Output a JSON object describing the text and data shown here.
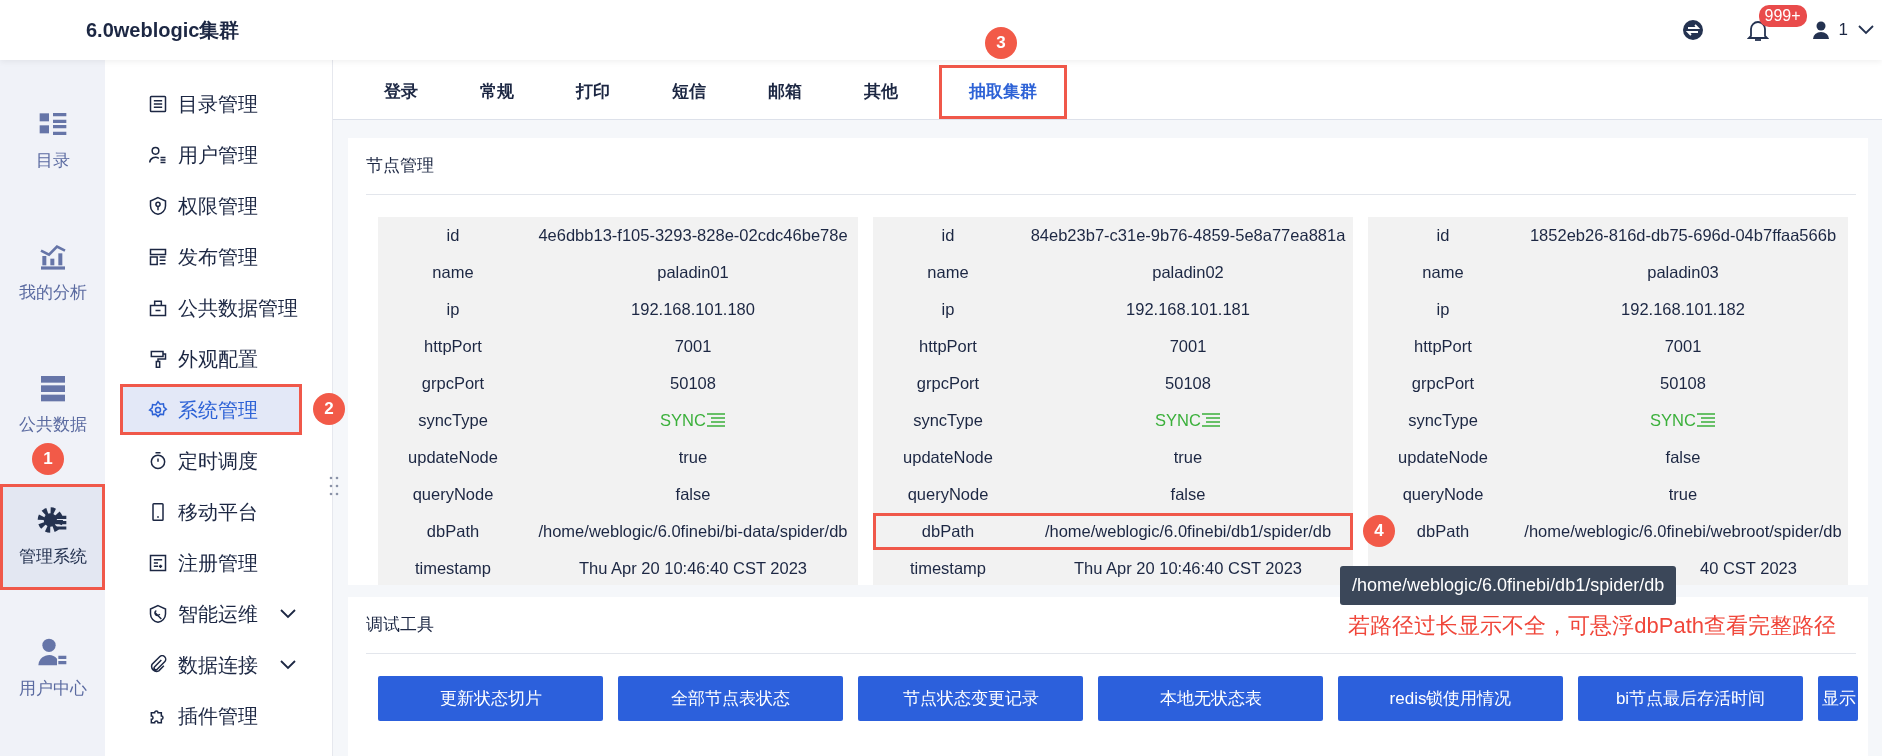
{
  "header": {
    "title": "6.0weblogic集群",
    "notification_badge": "999+",
    "user": "1"
  },
  "rail": [
    {
      "label": "目录",
      "selected": false,
      "highlighted": false
    },
    {
      "label": "我的分析",
      "selected": false,
      "highlighted": false
    },
    {
      "label": "公共数据",
      "selected": false,
      "highlighted": false
    },
    {
      "label": "管理系统",
      "selected": true,
      "highlighted": true,
      "callout": "1"
    },
    {
      "label": "用户中心",
      "selected": false,
      "highlighted": false
    }
  ],
  "nav": [
    {
      "label": "目录管理",
      "selected": false,
      "expandable": false
    },
    {
      "label": "用户管理",
      "selected": false,
      "expandable": false
    },
    {
      "label": "权限管理",
      "selected": false,
      "expandable": false
    },
    {
      "label": "发布管理",
      "selected": false,
      "expandable": false
    },
    {
      "label": "公共数据管理",
      "selected": false,
      "expandable": false
    },
    {
      "label": "外观配置",
      "selected": false,
      "expandable": false
    },
    {
      "label": "系统管理",
      "selected": true,
      "expandable": false,
      "highlighted": true,
      "callout": "2"
    },
    {
      "label": "定时调度",
      "selected": false,
      "expandable": false
    },
    {
      "label": "移动平台",
      "selected": false,
      "expandable": false
    },
    {
      "label": "注册管理",
      "selected": false,
      "expandable": false
    },
    {
      "label": "智能运维",
      "selected": false,
      "expandable": true
    },
    {
      "label": "数据连接",
      "selected": false,
      "expandable": true
    },
    {
      "label": "插件管理",
      "selected": false,
      "expandable": false
    }
  ],
  "tabs": [
    {
      "label": "登录",
      "selected": false
    },
    {
      "label": "常规",
      "selected": false
    },
    {
      "label": "打印",
      "selected": false
    },
    {
      "label": "短信",
      "selected": false
    },
    {
      "label": "邮箱",
      "selected": false
    },
    {
      "label": "其他",
      "selected": false
    },
    {
      "label": "抽取集群",
      "selected": true,
      "highlighted": true,
      "callout": "3"
    }
  ],
  "node_panel": {
    "title": "节点管理",
    "nodes": [
      {
        "rows": [
          {
            "key": "id",
            "value": "4e6dbb13-f105-3293-828e-02cdc46be78e"
          },
          {
            "key": "name",
            "value": "paladin01"
          },
          {
            "key": "ip",
            "value": "192.168.101.180"
          },
          {
            "key": "httpPort",
            "value": "7001"
          },
          {
            "key": "grpcPort",
            "value": "50108"
          },
          {
            "key": "syncType",
            "value": "SYNC",
            "kind": "sync"
          },
          {
            "key": "updateNode",
            "value": "true"
          },
          {
            "key": "queryNode",
            "value": "false"
          },
          {
            "key": "dbPath",
            "value": "/home/weblogic/6.0finebi/bi-data/spider/db"
          },
          {
            "key": "timestamp",
            "value": "Thu Apr 20 10:46:40 CST 2023"
          }
        ]
      },
      {
        "rows": [
          {
            "key": "id",
            "value": "84eb23b7-c31e-9b76-4859-5e8a77ea881a"
          },
          {
            "key": "name",
            "value": "paladin02"
          },
          {
            "key": "ip",
            "value": "192.168.101.181"
          },
          {
            "key": "httpPort",
            "value": "7001"
          },
          {
            "key": "grpcPort",
            "value": "50108"
          },
          {
            "key": "syncType",
            "value": "SYNC",
            "kind": "sync"
          },
          {
            "key": "updateNode",
            "value": "true"
          },
          {
            "key": "queryNode",
            "value": "false"
          },
          {
            "key": "dbPath",
            "value": "/home/weblogic/6.0finebi/db1/spider/db",
            "highlighted": true,
            "callout": "4"
          },
          {
            "key": "timestamp",
            "value": "Thu Apr 20 10:46:40 CST 2023"
          }
        ]
      },
      {
        "rows": [
          {
            "key": "id",
            "value": "1852eb26-816d-db75-696d-04b7ffaa566b"
          },
          {
            "key": "name",
            "value": "paladin03"
          },
          {
            "key": "ip",
            "value": "192.168.101.182"
          },
          {
            "key": "httpPort",
            "value": "7001"
          },
          {
            "key": "grpcPort",
            "value": "50108"
          },
          {
            "key": "syncType",
            "value": "SYNC",
            "kind": "sync"
          },
          {
            "key": "updateNode",
            "value": "false"
          },
          {
            "key": "queryNode",
            "value": "true"
          },
          {
            "key": "dbPath",
            "value": "/home/weblogic/6.0finebi/webroot/spider/db"
          },
          {
            "value": "40 CST 2023",
            "kind": "covered"
          }
        ]
      }
    ],
    "tooltip": "/home/weblogic/6.0finebi/db1/spider/db"
  },
  "debug_panel": {
    "title": "调试工具",
    "note": "若路径过长显示不全，可悬浮dbPath查看完整路径",
    "buttons": [
      "更新状态切片",
      "全部节点表状态",
      "节点状态变更记录",
      "本地无状态表",
      "redis锁使用情况",
      "bi节点最后存活时间",
      "显示"
    ]
  }
}
